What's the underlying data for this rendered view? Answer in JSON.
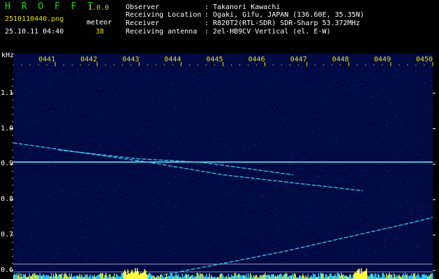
{
  "header": {
    "logo": "H R O F F T",
    "version": "1.0.0",
    "file_name": "2510110440.png",
    "timestamp": "25.10.11 04:40",
    "meteor_label": "meteor",
    "meteor_count": "38",
    "info_rows": [
      {
        "label": "Observer",
        "value": ": Takanori Kawachi"
      },
      {
        "label": "Receiving Location",
        "value": ": Ogaki, Gifu, JAPAN (136.60E, 35.35N)"
      },
      {
        "label": "Receiver",
        "value": ": R820T2(RTL-SDR) SDR-Sharp 53.372MHz"
      },
      {
        "label": "Receiving antenna",
        "value": ": 2el-HB9CV Vertical (el. E-W)"
      }
    ]
  },
  "chart_data": {
    "type": "heatmap",
    "ylabel": "kHz",
    "y_ticks": [
      "1.1",
      "1.0",
      "0.9",
      "0.8",
      "0.7",
      "0.6"
    ],
    "x_ticks": [
      "0441",
      "0442",
      "0443",
      "0444",
      "0445",
      "0446",
      "0447",
      "0448",
      "0449",
      "0450"
    ],
    "ylim": [
      0.58,
      1.18
    ],
    "colors": {
      "background": "#010a42",
      "trace": "#40c8ff",
      "carrier": "#5fe8ff",
      "bright": "#ffff40",
      "ticks": "#e8e000"
    },
    "carrier_khz": 0.906,
    "traces": [
      {
        "x": [
          "04:40:00",
          "04:43:15",
          "04:45:00",
          "04:48:20"
        ],
        "y": [
          0.96,
          0.905,
          0.87,
          0.825
        ]
      },
      {
        "x": [
          "04:41:05",
          "04:43:00",
          "04:44:30",
          "04:46:40"
        ],
        "y": [
          0.94,
          0.915,
          0.905,
          0.87
        ]
      },
      {
        "x": [
          "04:43:35",
          "04:45:00",
          "04:46:30",
          "04:48:00",
          "04:49:30",
          "04:50:00"
        ],
        "y": [
          0.588,
          0.62,
          0.655,
          0.695,
          0.735,
          0.75
        ]
      }
    ],
    "reference_lines_khz": [
      0.618,
      0.596
    ]
  }
}
